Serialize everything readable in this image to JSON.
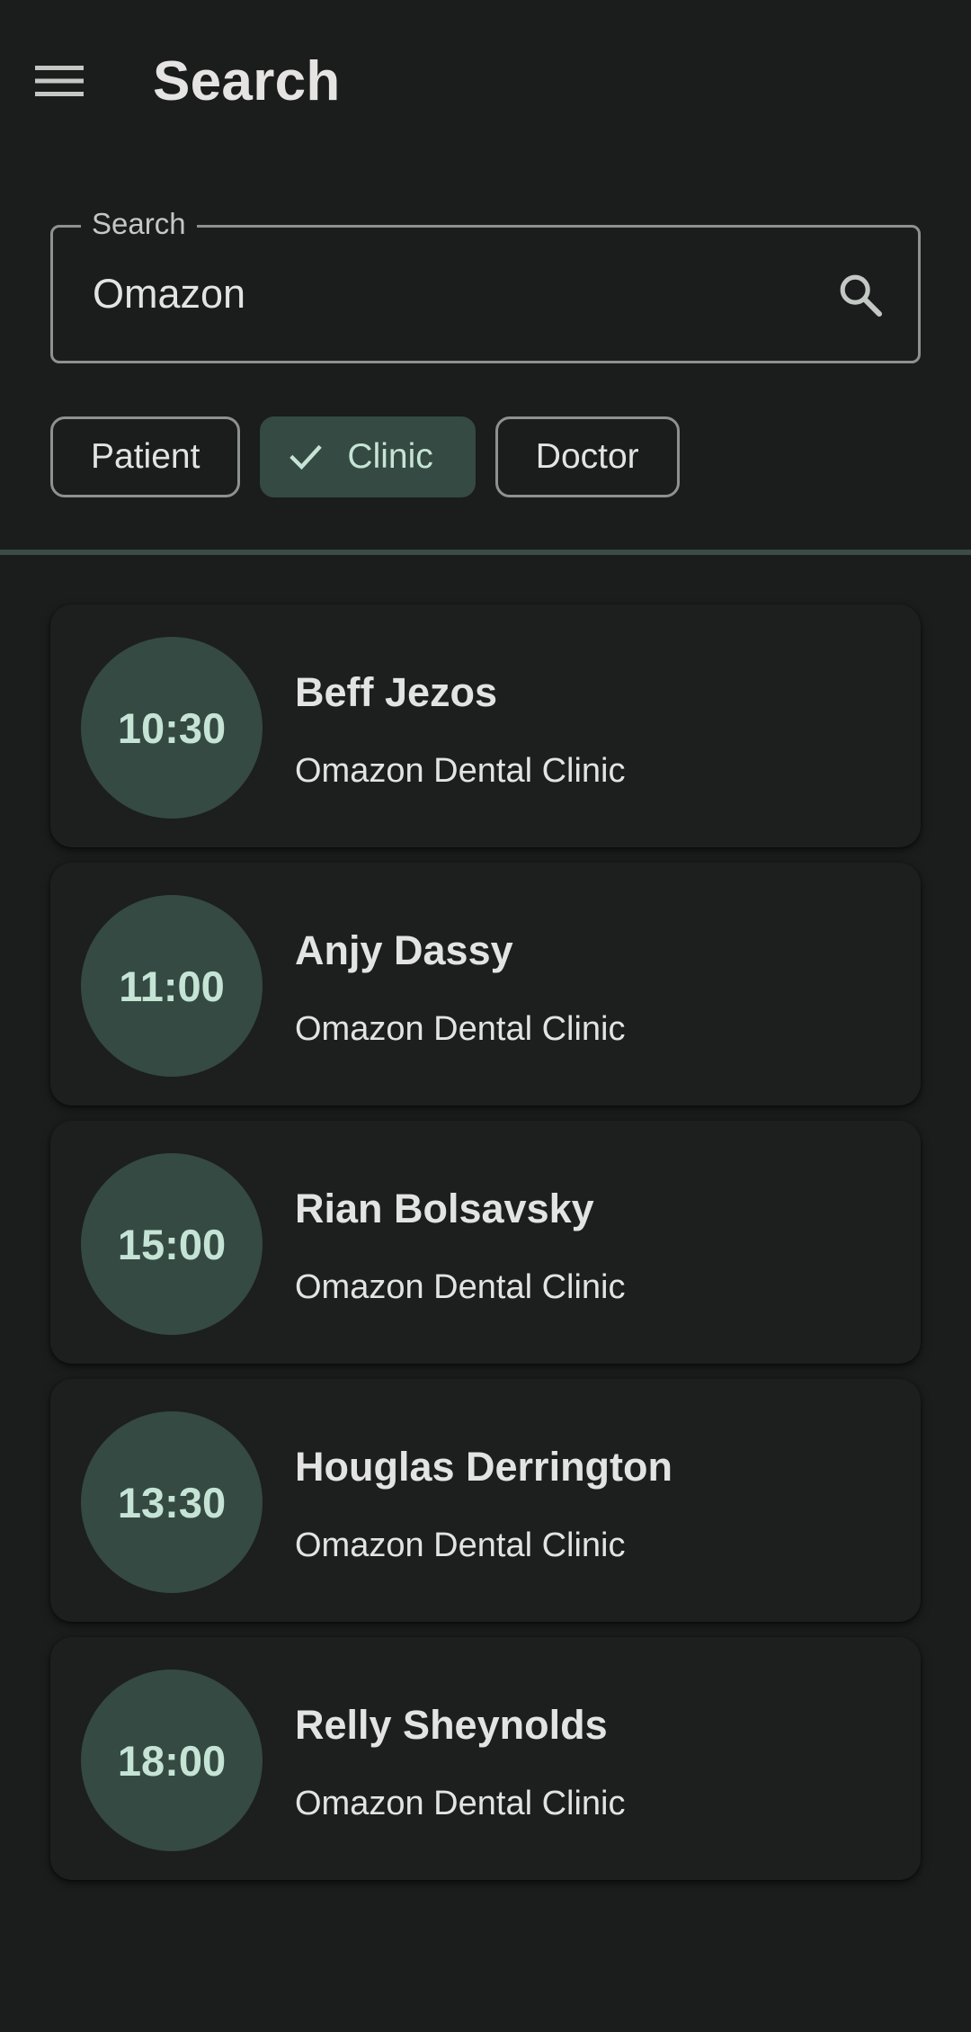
{
  "header": {
    "title": "Search",
    "menu_icon": "menu-icon"
  },
  "search": {
    "label": "Search",
    "value": "Omazon",
    "icon": "search-icon"
  },
  "filters": [
    {
      "label": "Patient",
      "selected": false
    },
    {
      "label": "Clinic",
      "selected": true
    },
    {
      "label": "Doctor",
      "selected": false
    }
  ],
  "results": [
    {
      "time": "10:30",
      "name": "Beff Jezos",
      "clinic": "Omazon Dental Clinic"
    },
    {
      "time": "11:00",
      "name": "Anjy Dassy",
      "clinic": "Omazon Dental Clinic"
    },
    {
      "time": "15:00",
      "name": "Rian Bolsavsky",
      "clinic": "Omazon Dental Clinic"
    },
    {
      "time": "13:30",
      "name": "Houglas Derrington",
      "clinic": "Omazon Dental Clinic"
    },
    {
      "time": "18:00",
      "name": "Relly Sheynolds",
      "clinic": "Omazon Dental Clinic"
    }
  ],
  "colors": {
    "background": "#1b1c1c",
    "accent_container": "#344a42",
    "on_accent": "#c6e4d6",
    "outline": "#8d9290"
  }
}
